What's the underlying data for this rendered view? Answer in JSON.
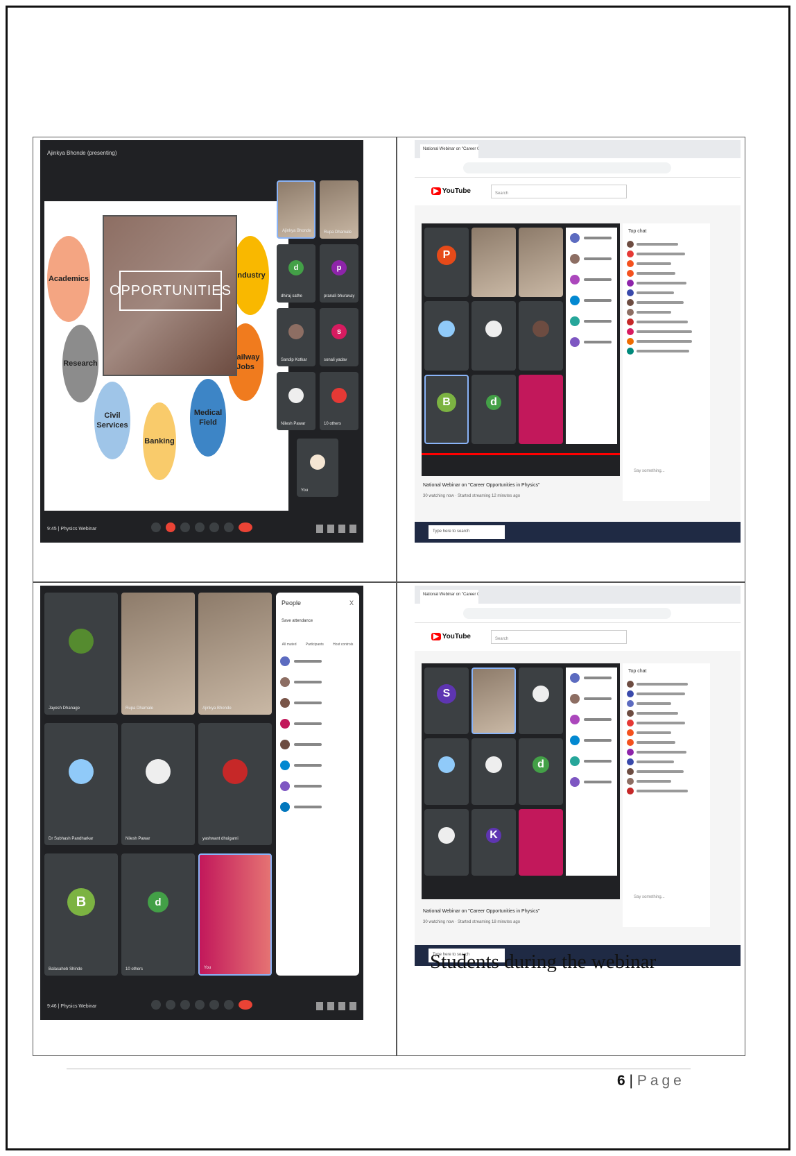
{
  "caption": "Students during the webinar",
  "footer": {
    "page_number": "6",
    "separator": " | ",
    "page_word": "Page"
  },
  "meet_top": {
    "presenter_bar": "Ajinkya Bhonde (presenting)",
    "time": "9:45 | Physics Webinar",
    "slide": {
      "center_text": "OPPORTUNITIES",
      "bubbles": {
        "academics": "Academics",
        "industry": "Industry",
        "research": "Research",
        "railway": "Railway Jobs",
        "civil": "Civil Services",
        "banking": "Banking",
        "medical": "Medical Field"
      }
    },
    "participants": [
      {
        "name": "Ajinkya Bhonde",
        "initial": ""
      },
      {
        "name": "Rupa Dhamale",
        "initial": ""
      },
      {
        "name": "dhiraj sathe",
        "initial": "d"
      },
      {
        "name": "pranali bhuravay",
        "initial": "p"
      },
      {
        "name": "Sandip Kotkar",
        "initial": ""
      },
      {
        "name": "sonali yadav",
        "initial": "s"
      },
      {
        "name": "Nilesh Pawar",
        "initial": ""
      },
      {
        "name": "10 others",
        "initial": ""
      },
      {
        "name": "You",
        "initial": ""
      }
    ]
  },
  "meet_bottom": {
    "time": "9:46 | Physics Webinar",
    "people_panel": {
      "title": "People",
      "close": "X",
      "save_attendance": "Save attendance",
      "tabs": [
        "All muted",
        "Participants",
        "Host controls"
      ]
    },
    "participants": [
      {
        "name": "Jayesh Dhanage",
        "initial": ""
      },
      {
        "name": "Rupa Dhamale",
        "initial": ""
      },
      {
        "name": "Ajinkya Bhonde",
        "initial": ""
      },
      {
        "name": "Dr Subhash Pandharkar",
        "initial": ""
      },
      {
        "name": "Nilesh Pawar",
        "initial": ""
      },
      {
        "name": "yashwant dhuigarni",
        "initial": ""
      },
      {
        "name": "Balasaheb Shinde",
        "initial": "B"
      },
      {
        "name": "10 others",
        "initial": "d"
      },
      {
        "name": "You",
        "initial": ""
      }
    ]
  },
  "youtube_top": {
    "tab_label": "National Webinar on \"Career Opportunities in Physics\"",
    "search_placeholder": "Search",
    "video_title": "National Webinar on \"Career Opportunities in Physics\"",
    "stats": "30 watching now · Started streaming 12 minutes ago",
    "chat_title": "Top chat",
    "chat_placeholder": "Say something...",
    "taskbar_search": "Type here to search"
  },
  "youtube_bottom": {
    "tab_label": "National Webinar on \"Career Opportunities in Physics\"",
    "search_placeholder": "Search",
    "video_title": "National Webinar on \"Career Opportunities in Physics\"",
    "stats": "30 watching now · Started streaming 18 minutes ago",
    "chat_title": "Top chat",
    "chat_placeholder": "Say something...",
    "taskbar_search": "Type here to search"
  },
  "colors": {
    "academics": "#f4a582",
    "industry": "#f9b800",
    "research": "#8c8c8c",
    "railway": "#f07b1e",
    "civil": "#9fc5e8",
    "banking": "#f9cb6b",
    "medical": "#3d85c6",
    "meet_bg": "#202124",
    "end_call": "#ea4335"
  }
}
